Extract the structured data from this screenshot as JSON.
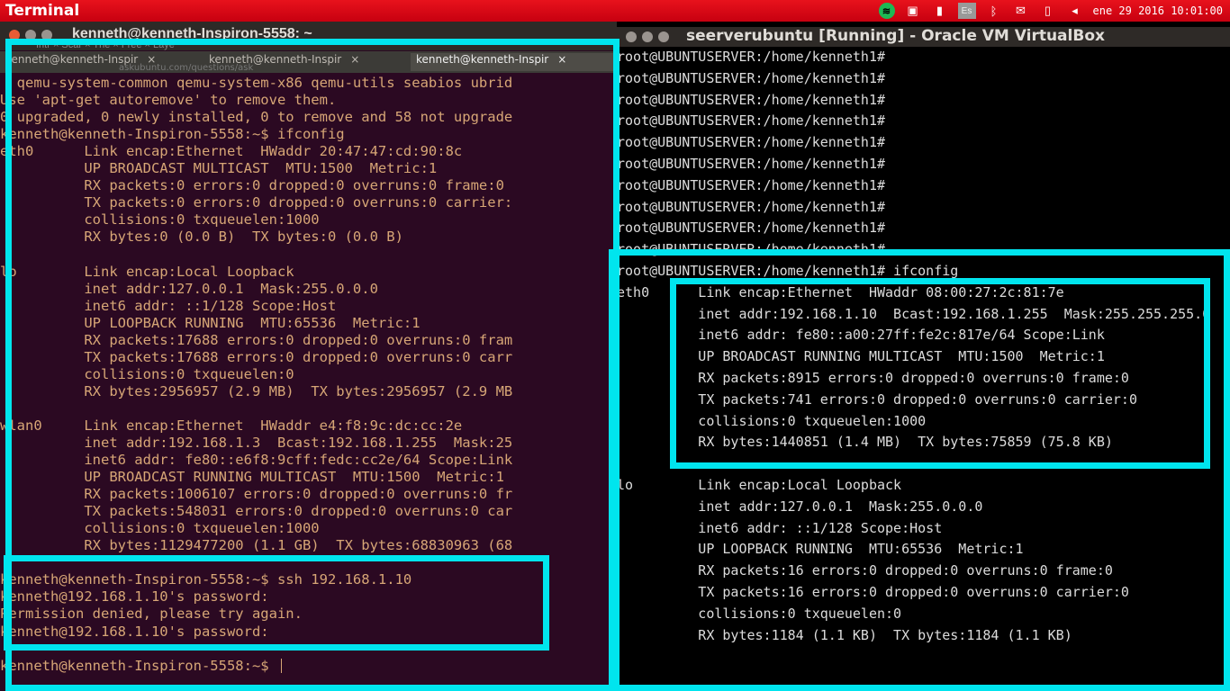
{
  "topbar": {
    "app_title": "Terminal",
    "tray_icons": [
      "spotify-icon",
      "image-viewer-icon",
      "signal-icon",
      "keyboard-layout-icon",
      "bluetooth-icon",
      "mail-icon",
      "battery-icon",
      "volume-icon"
    ],
    "keyboard_layout": "Es",
    "clock": "ene 29 2016 10:01:00",
    "bar_color": "#d9001a"
  },
  "terminal": {
    "title": "kenneth@kenneth-Inspiron-5558: ~",
    "ghost_tabs": "Intr  ×   Scar  ×   The   ×   Free  ×   Laye",
    "tabs": [
      {
        "label": "kenneth@kenneth-Inspir",
        "close": "×"
      },
      {
        "label": "kenneth@kenneth-Inspir",
        "close": "×"
      },
      {
        "label": "kenneth@kenneth-Inspir",
        "close": "×"
      }
    ],
    "overlay_text": "askubuntu.com/questions/ask",
    "lines": [
      "  qemu-system-common qemu-system-x86 qemu-utils seabios ubrid",
      "Use 'apt-get autoremove' to remove them.",
      "0 upgraded, 0 newly installed, 0 to remove and 58 not upgrade",
      "kenneth@kenneth-Inspiron-5558:~$ ifconfig",
      "eth0      Link encap:Ethernet  HWaddr 20:47:47:cd:90:8c",
      "          UP BROADCAST MULTICAST  MTU:1500  Metric:1",
      "          RX packets:0 errors:0 dropped:0 overruns:0 frame:0",
      "          TX packets:0 errors:0 dropped:0 overruns:0 carrier:",
      "          collisions:0 txqueuelen:1000",
      "          RX bytes:0 (0.0 B)  TX bytes:0 (0.0 B)",
      "",
      "lo        Link encap:Local Loopback",
      "          inet addr:127.0.0.1  Mask:255.0.0.0",
      "          inet6 addr: ::1/128 Scope:Host",
      "          UP LOOPBACK RUNNING  MTU:65536  Metric:1",
      "          RX packets:17688 errors:0 dropped:0 overruns:0 fram",
      "          TX packets:17688 errors:0 dropped:0 overruns:0 carr",
      "          collisions:0 txqueuelen:0",
      "          RX bytes:2956957 (2.9 MB)  TX bytes:2956957 (2.9 MB",
      "",
      "wlan0     Link encap:Ethernet  HWaddr e4:f8:9c:dc:cc:2e",
      "          inet addr:192.168.1.3  Bcast:192.168.1.255  Mask:25",
      "          inet6 addr: fe80::e6f8:9cff:fedc:cc2e/64 Scope:Link",
      "          UP BROADCAST RUNNING MULTICAST  MTU:1500  Metric:1",
      "          RX packets:1006107 errors:0 dropped:0 overruns:0 fr",
      "          TX packets:548031 errors:0 dropped:0 overruns:0 car",
      "          collisions:0 txqueuelen:1000",
      "          RX bytes:1129477200 (1.1 GB)  TX bytes:68830963 (68",
      "",
      "kenneth@kenneth-Inspiron-5558:~$ ssh 192.168.1.10",
      "kenneth@192.168.1.10's password:",
      "Permission denied, please try again.",
      "kenneth@192.168.1.10's password:",
      "",
      "kenneth@kenneth-Inspiron-5558:~$ "
    ],
    "text_color": "#d7a676",
    "background": "#2b0922"
  },
  "virtualbox": {
    "title": "seerverubuntu [Running] - Oracle VM VirtualBox",
    "lines": [
      "root@UBUNTUSERVER:/home/kenneth1#",
      "root@UBUNTUSERVER:/home/kenneth1#",
      "root@UBUNTUSERVER:/home/kenneth1#",
      "root@UBUNTUSERVER:/home/kenneth1#",
      "root@UBUNTUSERVER:/home/kenneth1#",
      "root@UBUNTUSERVER:/home/kenneth1#",
      "root@UBUNTUSERVER:/home/kenneth1#",
      "root@UBUNTUSERVER:/home/kenneth1#",
      "root@UBUNTUSERVER:/home/kenneth1#",
      "root@UBUNTUSERVER:/home/kenneth1#",
      "root@UBUNTUSERVER:/home/kenneth1# ifconfig",
      "eth0      Link encap:Ethernet  HWaddr 08:00:27:2c:81:7e",
      "          inet addr:192.168.1.10  Bcast:192.168.1.255  Mask:255.255.255.0",
      "          inet6 addr: fe80::a00:27ff:fe2c:817e/64 Scope:Link",
      "          UP BROADCAST RUNNING MULTICAST  MTU:1500  Metric:1",
      "          RX packets:8915 errors:0 dropped:0 overruns:0 frame:0",
      "          TX packets:741 errors:0 dropped:0 overruns:0 carrier:0",
      "          collisions:0 txqueuelen:1000",
      "          RX bytes:1440851 (1.4 MB)  TX bytes:75859 (75.8 KB)",
      "",
      "lo        Link encap:Local Loopback",
      "          inet addr:127.0.0.1  Mask:255.0.0.0",
      "          inet6 addr: ::1/128 Scope:Host",
      "          UP LOOPBACK RUNNING  MTU:65536  Metric:1",
      "          RX packets:16 errors:0 dropped:0 overruns:0 frame:0",
      "          TX packets:16 errors:0 dropped:0 overruns:0 carrier:0",
      "          collisions:0 txqueuelen:0",
      "          RX bytes:1184 (1.1 KB)  TX bytes:1184 (1.1 KB)",
      "",
      "root@UBUNTUSERVER:/home/kenneth1#"
    ],
    "text_color": "#dcdcdc"
  },
  "highlight_color": "#00e5ee"
}
